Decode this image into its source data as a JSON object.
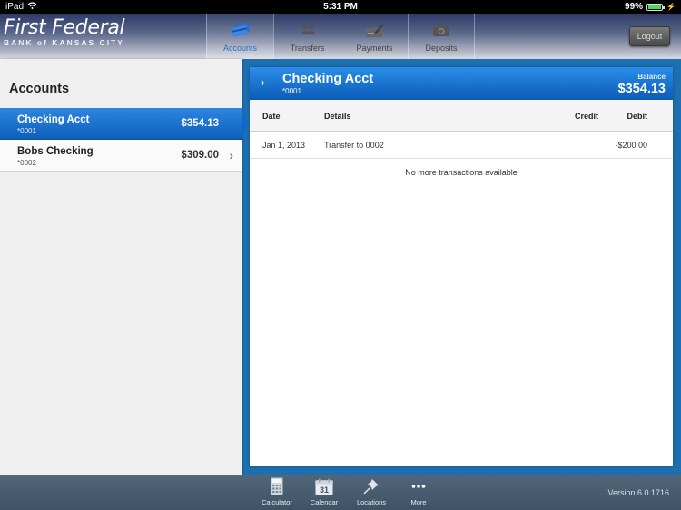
{
  "status_bar": {
    "device": "iPad",
    "time": "5:31 PM",
    "battery": "99%",
    "battery_level": 0.99
  },
  "header": {
    "brand_name": "First Federal",
    "brand_sub": "BANK of KANSAS CITY",
    "tabs": [
      {
        "label": "Accounts",
        "icon": "credit-card-icon",
        "active": true
      },
      {
        "label": "Transfers",
        "icon": "transfer-arrows-icon",
        "active": false
      },
      {
        "label": "Payments",
        "icon": "check-pen-icon",
        "active": false
      },
      {
        "label": "Deposits",
        "icon": "camera-icon",
        "active": false
      }
    ],
    "logout_label": "Logout"
  },
  "sidebar": {
    "title": "Accounts",
    "accounts": [
      {
        "name": "Checking Acct",
        "number": "*0001",
        "balance": "$354.13",
        "selected": true
      },
      {
        "name": "Bobs Checking",
        "number": "*0002",
        "balance": "$309.00",
        "selected": false
      }
    ]
  },
  "detail": {
    "account_name": "Checking Acct",
    "account_number": "*0001",
    "balance_label": "Balance",
    "balance": "$354.13",
    "columns": {
      "date": "Date",
      "details": "Details",
      "credit": "Credit",
      "debit": "Debit"
    },
    "transactions": [
      {
        "date": "Jan 1, 2013",
        "details": "Transfer to 0002",
        "credit": "",
        "debit": "-$200.00"
      }
    ],
    "empty_message": "No more transactions available"
  },
  "bottom_bar": {
    "tools": [
      {
        "label": "Calculator",
        "icon": "calculator-icon"
      },
      {
        "label": "Calendar",
        "icon": "calendar-icon",
        "badge": "31"
      },
      {
        "label": "Locations",
        "icon": "pushpin-icon"
      },
      {
        "label": "More",
        "icon": "more-dots-icon"
      }
    ],
    "version": "Version 6.0.1716"
  }
}
